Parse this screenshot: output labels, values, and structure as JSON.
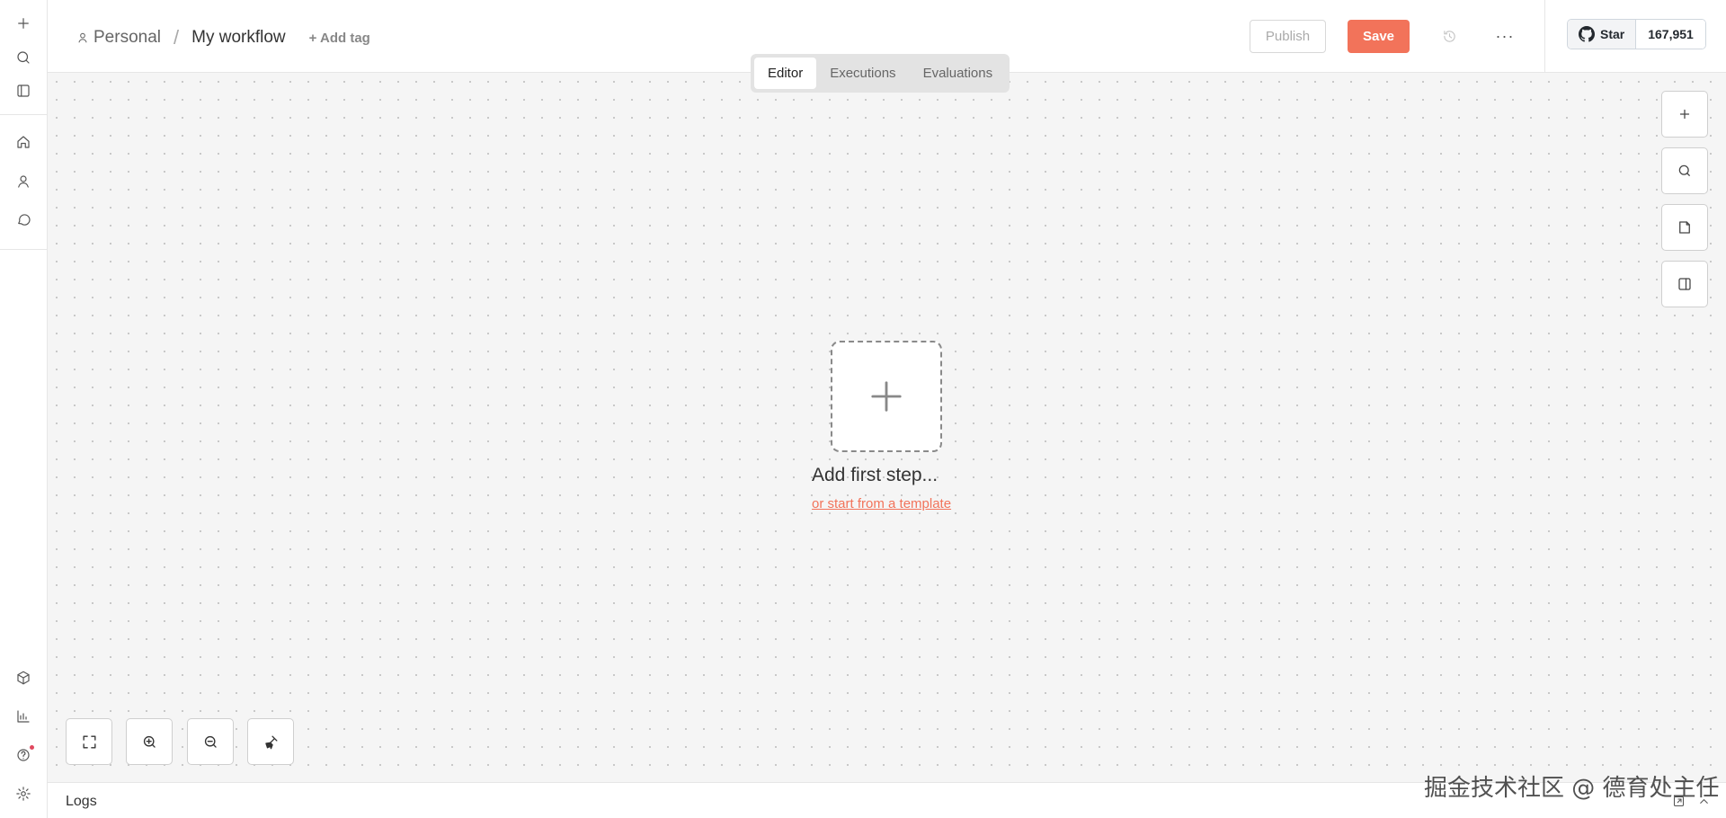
{
  "breadcrumb": {
    "project": "Personal",
    "separator": "/",
    "workflow_name": "My workflow",
    "add_tag": "+ Add tag"
  },
  "header": {
    "publish_label": "Publish",
    "save_label": "Save",
    "more_label": "···",
    "github": {
      "star_label": "Star",
      "star_count": "167,951"
    }
  },
  "tabs": [
    {
      "label": "Editor",
      "active": true
    },
    {
      "label": "Executions",
      "active": false
    },
    {
      "label": "Evaluations",
      "active": false
    }
  ],
  "canvas": {
    "add_first_step": "Add first step...",
    "start_from_template": "or start from a template"
  },
  "logs": {
    "label": "Logs"
  },
  "watermark": "掘金技术社区 @ 德育处主任",
  "colors": {
    "accent": "#f2735a",
    "canvas_bg": "#f5f5f5",
    "notification_dot": "#e0495f"
  }
}
